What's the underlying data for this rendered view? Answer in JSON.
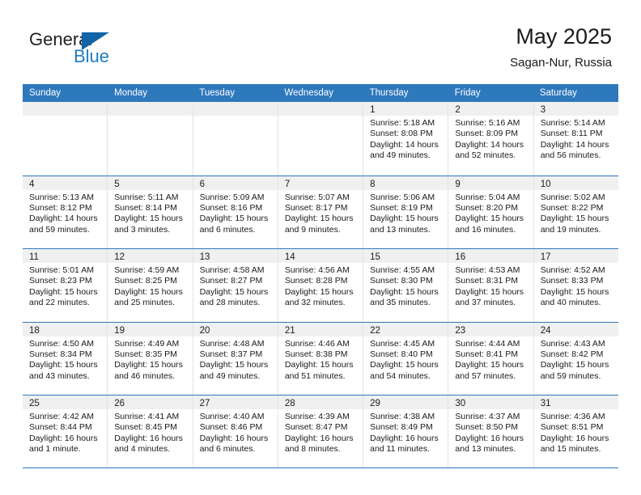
{
  "brand": {
    "name_part1": "General",
    "name_part2": "Blue",
    "triangle_color": "#1063a8",
    "blue_color": "#1f7cc1"
  },
  "header": {
    "title": "May 2025",
    "subtitle": "Sagan-Nur, Russia"
  },
  "theme": {
    "header_bar": "#2e78bc",
    "day_band": "#f0f0f0",
    "grid_line": "#e3e3e3",
    "text": "#1a1a1a"
  },
  "weekdays": [
    "Sunday",
    "Monday",
    "Tuesday",
    "Wednesday",
    "Thursday",
    "Friday",
    "Saturday"
  ],
  "weeks": [
    [
      {
        "day": "",
        "empty": true
      },
      {
        "day": "",
        "empty": true
      },
      {
        "day": "",
        "empty": true
      },
      {
        "day": "",
        "empty": true
      },
      {
        "day": "1",
        "sunrise": "Sunrise: 5:18 AM",
        "sunset": "Sunset: 8:08 PM",
        "daylight": "Daylight: 14 hours and 49 minutes."
      },
      {
        "day": "2",
        "sunrise": "Sunrise: 5:16 AM",
        "sunset": "Sunset: 8:09 PM",
        "daylight": "Daylight: 14 hours and 52 minutes."
      },
      {
        "day": "3",
        "sunrise": "Sunrise: 5:14 AM",
        "sunset": "Sunset: 8:11 PM",
        "daylight": "Daylight: 14 hours and 56 minutes."
      }
    ],
    [
      {
        "day": "4",
        "sunrise": "Sunrise: 5:13 AM",
        "sunset": "Sunset: 8:12 PM",
        "daylight": "Daylight: 14 hours and 59 minutes."
      },
      {
        "day": "5",
        "sunrise": "Sunrise: 5:11 AM",
        "sunset": "Sunset: 8:14 PM",
        "daylight": "Daylight: 15 hours and 3 minutes."
      },
      {
        "day": "6",
        "sunrise": "Sunrise: 5:09 AM",
        "sunset": "Sunset: 8:16 PM",
        "daylight": "Daylight: 15 hours and 6 minutes."
      },
      {
        "day": "7",
        "sunrise": "Sunrise: 5:07 AM",
        "sunset": "Sunset: 8:17 PM",
        "daylight": "Daylight: 15 hours and 9 minutes."
      },
      {
        "day": "8",
        "sunrise": "Sunrise: 5:06 AM",
        "sunset": "Sunset: 8:19 PM",
        "daylight": "Daylight: 15 hours and 13 minutes."
      },
      {
        "day": "9",
        "sunrise": "Sunrise: 5:04 AM",
        "sunset": "Sunset: 8:20 PM",
        "daylight": "Daylight: 15 hours and 16 minutes."
      },
      {
        "day": "10",
        "sunrise": "Sunrise: 5:02 AM",
        "sunset": "Sunset: 8:22 PM",
        "daylight": "Daylight: 15 hours and 19 minutes."
      }
    ],
    [
      {
        "day": "11",
        "sunrise": "Sunrise: 5:01 AM",
        "sunset": "Sunset: 8:23 PM",
        "daylight": "Daylight: 15 hours and 22 minutes."
      },
      {
        "day": "12",
        "sunrise": "Sunrise: 4:59 AM",
        "sunset": "Sunset: 8:25 PM",
        "daylight": "Daylight: 15 hours and 25 minutes."
      },
      {
        "day": "13",
        "sunrise": "Sunrise: 4:58 AM",
        "sunset": "Sunset: 8:27 PM",
        "daylight": "Daylight: 15 hours and 28 minutes."
      },
      {
        "day": "14",
        "sunrise": "Sunrise: 4:56 AM",
        "sunset": "Sunset: 8:28 PM",
        "daylight": "Daylight: 15 hours and 32 minutes."
      },
      {
        "day": "15",
        "sunrise": "Sunrise: 4:55 AM",
        "sunset": "Sunset: 8:30 PM",
        "daylight": "Daylight: 15 hours and 35 minutes."
      },
      {
        "day": "16",
        "sunrise": "Sunrise: 4:53 AM",
        "sunset": "Sunset: 8:31 PM",
        "daylight": "Daylight: 15 hours and 37 minutes."
      },
      {
        "day": "17",
        "sunrise": "Sunrise: 4:52 AM",
        "sunset": "Sunset: 8:33 PM",
        "daylight": "Daylight: 15 hours and 40 minutes."
      }
    ],
    [
      {
        "day": "18",
        "sunrise": "Sunrise: 4:50 AM",
        "sunset": "Sunset: 8:34 PM",
        "daylight": "Daylight: 15 hours and 43 minutes."
      },
      {
        "day": "19",
        "sunrise": "Sunrise: 4:49 AM",
        "sunset": "Sunset: 8:35 PM",
        "daylight": "Daylight: 15 hours and 46 minutes."
      },
      {
        "day": "20",
        "sunrise": "Sunrise: 4:48 AM",
        "sunset": "Sunset: 8:37 PM",
        "daylight": "Daylight: 15 hours and 49 minutes."
      },
      {
        "day": "21",
        "sunrise": "Sunrise: 4:46 AM",
        "sunset": "Sunset: 8:38 PM",
        "daylight": "Daylight: 15 hours and 51 minutes."
      },
      {
        "day": "22",
        "sunrise": "Sunrise: 4:45 AM",
        "sunset": "Sunset: 8:40 PM",
        "daylight": "Daylight: 15 hours and 54 minutes."
      },
      {
        "day": "23",
        "sunrise": "Sunrise: 4:44 AM",
        "sunset": "Sunset: 8:41 PM",
        "daylight": "Daylight: 15 hours and 57 minutes."
      },
      {
        "day": "24",
        "sunrise": "Sunrise: 4:43 AM",
        "sunset": "Sunset: 8:42 PM",
        "daylight": "Daylight: 15 hours and 59 minutes."
      }
    ],
    [
      {
        "day": "25",
        "sunrise": "Sunrise: 4:42 AM",
        "sunset": "Sunset: 8:44 PM",
        "daylight": "Daylight: 16 hours and 1 minute."
      },
      {
        "day": "26",
        "sunrise": "Sunrise: 4:41 AM",
        "sunset": "Sunset: 8:45 PM",
        "daylight": "Daylight: 16 hours and 4 minutes."
      },
      {
        "day": "27",
        "sunrise": "Sunrise: 4:40 AM",
        "sunset": "Sunset: 8:46 PM",
        "daylight": "Daylight: 16 hours and 6 minutes."
      },
      {
        "day": "28",
        "sunrise": "Sunrise: 4:39 AM",
        "sunset": "Sunset: 8:47 PM",
        "daylight": "Daylight: 16 hours and 8 minutes."
      },
      {
        "day": "29",
        "sunrise": "Sunrise: 4:38 AM",
        "sunset": "Sunset: 8:49 PM",
        "daylight": "Daylight: 16 hours and 11 minutes."
      },
      {
        "day": "30",
        "sunrise": "Sunrise: 4:37 AM",
        "sunset": "Sunset: 8:50 PM",
        "daylight": "Daylight: 16 hours and 13 minutes."
      },
      {
        "day": "31",
        "sunrise": "Sunrise: 4:36 AM",
        "sunset": "Sunset: 8:51 PM",
        "daylight": "Daylight: 16 hours and 15 minutes."
      }
    ]
  ]
}
